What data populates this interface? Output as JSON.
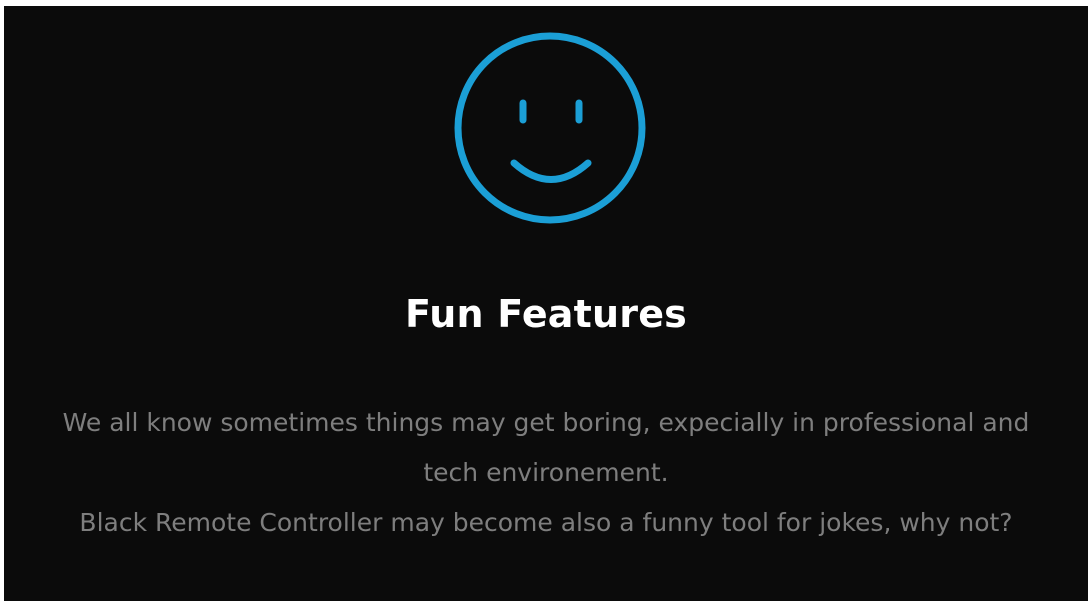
{
  "feature": {
    "icon": "smiley-face-icon",
    "title": "Fun Features",
    "paragraph_1": "We all know sometimes things may get boring, expecially in professional and tech environement.",
    "paragraph_2": "Black Remote Controller may become also a funny tool for jokes, why not?"
  },
  "colors": {
    "background": "#0b0b0b",
    "accent": "#1b9fd6",
    "title": "#ffffff",
    "text": "#7e7e7e"
  }
}
